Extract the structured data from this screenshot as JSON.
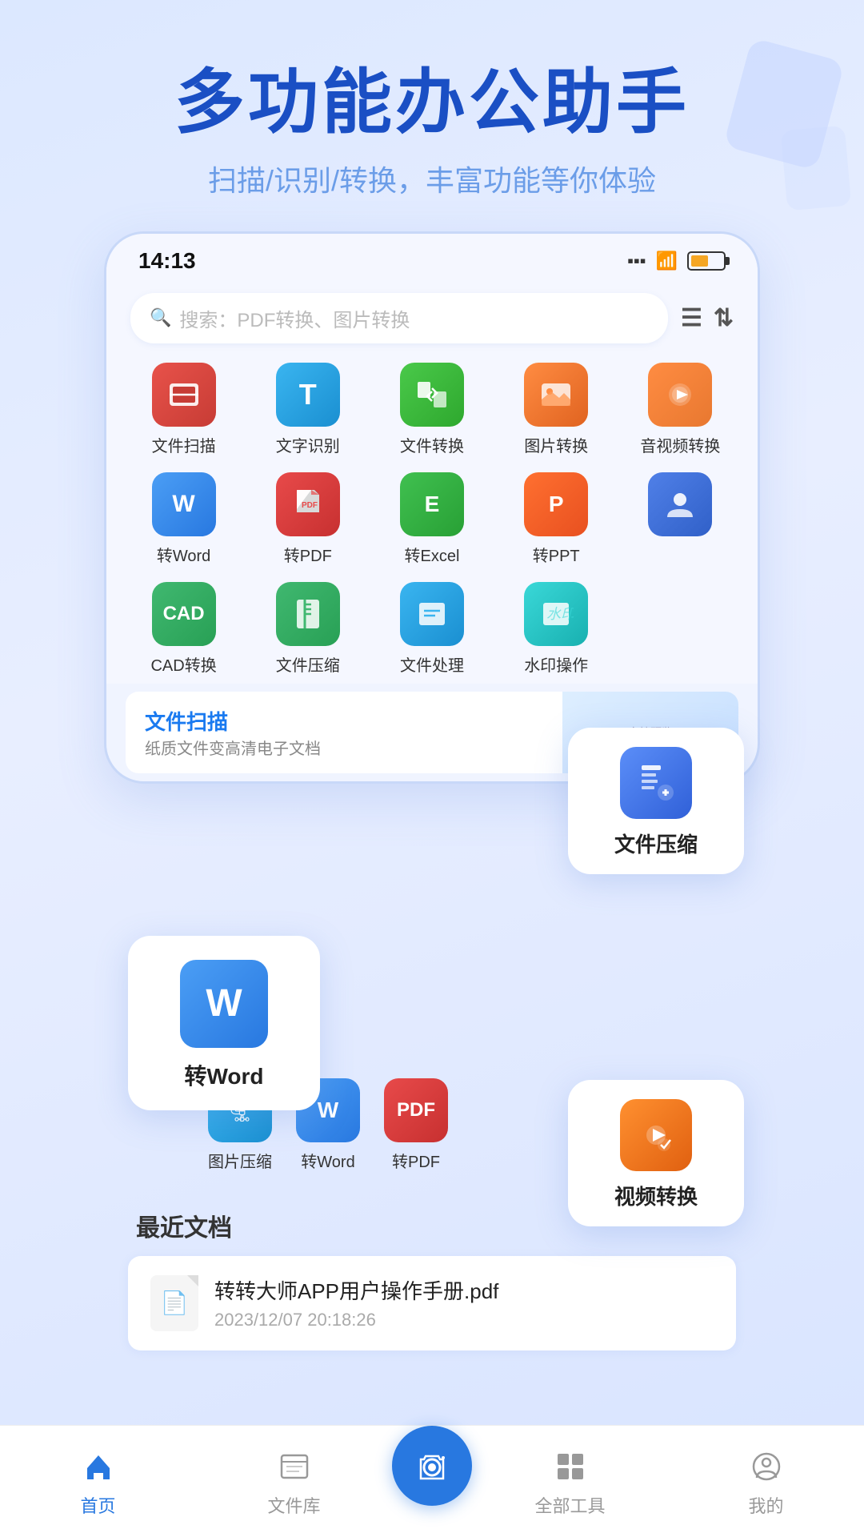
{
  "app": {
    "title": "多功能办公助手",
    "subtitle": "扫描/识别/转换，丰富功能等你体验"
  },
  "status_bar": {
    "time": "14:13"
  },
  "search": {
    "placeholder": "搜索：PDF转换、图片转换"
  },
  "grid_row1": [
    {
      "id": "scan",
      "label": "文件扫描",
      "color_class": "ic-scan",
      "icon": "📄"
    },
    {
      "id": "ocr",
      "label": "文字识别",
      "color_class": "ic-ocr",
      "icon": "T"
    },
    {
      "id": "convert",
      "label": "文件转换",
      "color_class": "ic-convert",
      "icon": "🔄"
    },
    {
      "id": "img-convert",
      "label": "图片转换",
      "color_class": "ic-img",
      "icon": "🖼"
    },
    {
      "id": "media-convert",
      "label": "音视频转换",
      "color_class": "ic-media",
      "icon": "🎵"
    }
  ],
  "grid_row2": [
    {
      "id": "to-word",
      "label": "转Word",
      "color_class": "ic-word",
      "icon": "W"
    },
    {
      "id": "to-pdf",
      "label": "转PDF",
      "color_class": "ic-pdf",
      "icon": "P"
    },
    {
      "id": "to-excel",
      "label": "转Excel",
      "color_class": "ic-excel",
      "icon": "E"
    },
    {
      "id": "to-ppt",
      "label": "转PPT",
      "color_class": "ic-ppt",
      "icon": "P"
    },
    {
      "id": "user",
      "label": "",
      "color_class": "ic-user",
      "icon": "👤"
    }
  ],
  "grid_row3": [
    {
      "id": "cad",
      "label": "CAD转换",
      "color_class": "ic-cad",
      "icon": "C"
    },
    {
      "id": "compress",
      "label": "文件压缩",
      "color_class": "ic-compress",
      "icon": "📦"
    },
    {
      "id": "file-proc",
      "label": "文件处理",
      "color_class": "ic-fileproc",
      "icon": "🔧"
    },
    {
      "id": "watermark",
      "label": "水印操作",
      "color_class": "ic-watermark",
      "icon": "💧"
    },
    {
      "id": "empty",
      "label": "",
      "color_class": "",
      "icon": ""
    }
  ],
  "banner": {
    "title": "文件扫描",
    "desc": "纸质文件变高清电子文档"
  },
  "floating_word": {
    "label": "转Word"
  },
  "floating_compress": {
    "label": "文件压缩"
  },
  "floating_video": {
    "label": "视频转换"
  },
  "mini_icons": [
    {
      "id": "img-compress",
      "label": "图片压缩",
      "color_class": "ic-ocr",
      "icon": "🗜"
    },
    {
      "id": "to-word2",
      "label": "转Word",
      "color_class": "ic-word",
      "icon": "W"
    },
    {
      "id": "to-pdf2",
      "label": "转PDF",
      "color_class": "ic-pdf",
      "icon": "P"
    }
  ],
  "recent": {
    "section_title": "最近文档",
    "items": [
      {
        "name": "转转大师APP用户操作手册.pdf",
        "date": "2023/12/07 20:18:26"
      }
    ]
  },
  "bottom_nav": {
    "items": [
      {
        "id": "home",
        "label": "首页",
        "icon": "🏠",
        "active": true
      },
      {
        "id": "files",
        "label": "文件库",
        "icon": "📋",
        "active": false
      },
      {
        "id": "camera",
        "label": "",
        "icon": "📷",
        "active": false,
        "center": true
      },
      {
        "id": "tools",
        "label": "全部工具",
        "icon": "⊞",
        "active": false
      },
      {
        "id": "mine",
        "label": "我的",
        "icon": "⊙",
        "active": false
      }
    ]
  }
}
